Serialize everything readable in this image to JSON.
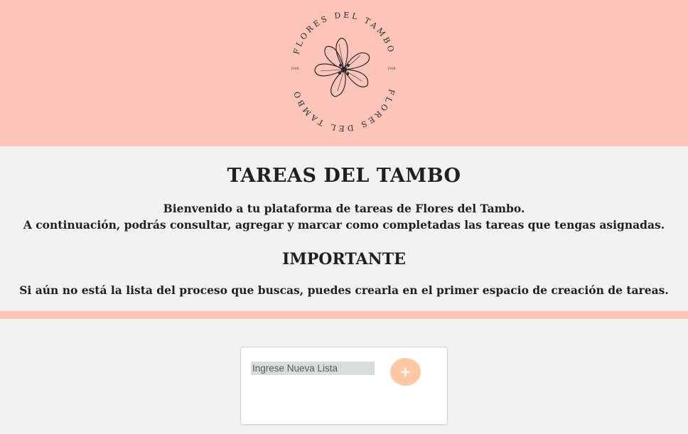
{
  "header": {
    "logo": {
      "text_top": "FLORES DEL TAMBO",
      "text_bottom": "FLORES DEL TAMBO",
      "year_left": "1998",
      "year_right": "1998"
    }
  },
  "intro": {
    "title": "TAREAS DEL TAMBO",
    "welcome_line1": "Bienvenido a tu plataforma de tareas de Flores del Tambo.",
    "welcome_line2": "A continuación, podrás consultar, agregar y marcar como completadas las tareas que tengas asignadas.",
    "important_heading": "IMPORTANTE",
    "important_note": "Si aún no está la lista del proceso que buscas, puedes crearla en el primer espacio de creación de tareas."
  },
  "new_list": {
    "placeholder": "Ingrese Nueva Lista",
    "value": "",
    "add_label": "+"
  },
  "colors": {
    "header_bg": "#fdc5ba",
    "page_bg": "#f4f2f1",
    "add_button": "#ffc8a2",
    "input_bg": "#d5ded9"
  }
}
